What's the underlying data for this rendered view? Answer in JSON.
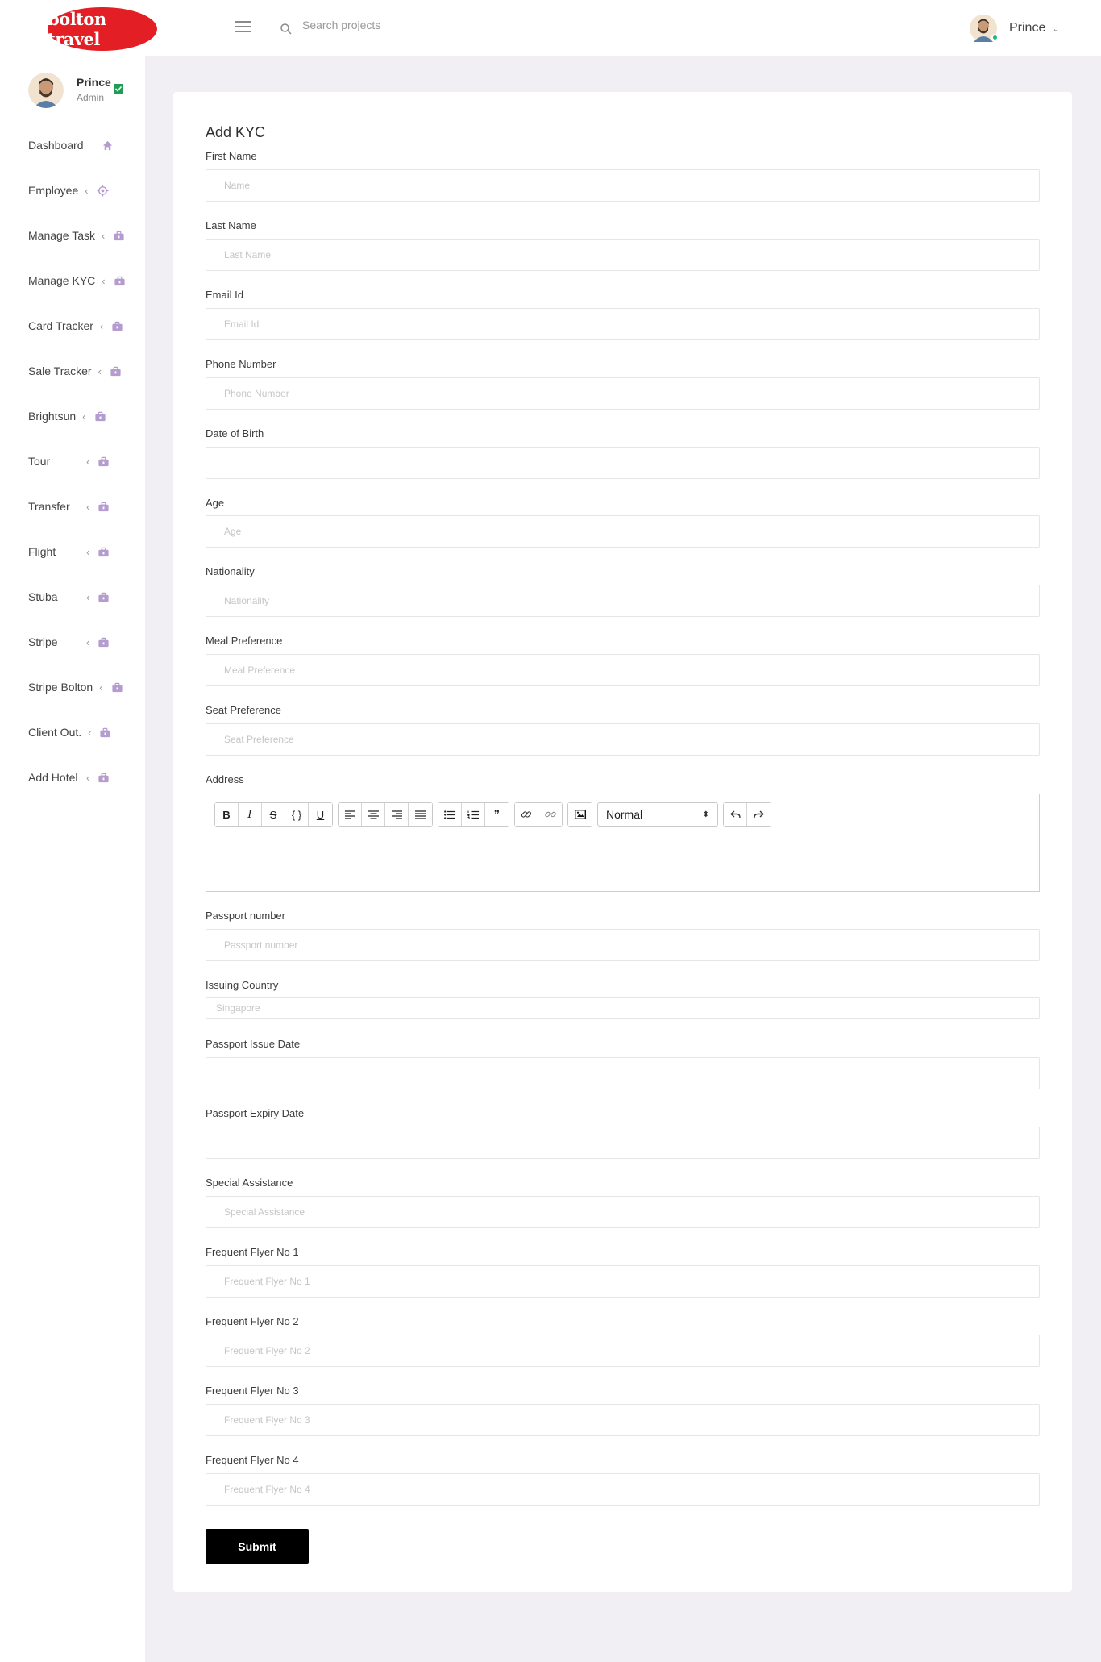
{
  "header": {
    "logo_text": "bolton travel",
    "search_placeholder": "Search projects",
    "user_name": "Prince"
  },
  "sidebar": {
    "profile": {
      "name": "Prince",
      "role": "Admin"
    },
    "items": [
      {
        "label": "Dashboard",
        "icon": "home-icon",
        "has_arrow": false
      },
      {
        "label": "Employee",
        "icon": "target-icon",
        "has_arrow": true
      },
      {
        "label": "Manage Task",
        "icon": "briefcase-icon",
        "has_arrow": true
      },
      {
        "label": "Manage KYC",
        "icon": "briefcase-icon",
        "has_arrow": true
      },
      {
        "label": "Card Tracker",
        "icon": "briefcase-icon",
        "has_arrow": true
      },
      {
        "label": "Sale Tracker",
        "icon": "briefcase-icon",
        "has_arrow": true
      },
      {
        "label": "Brightsun",
        "icon": "briefcase-icon",
        "has_arrow": true
      },
      {
        "label": "Tour",
        "icon": "briefcase-icon",
        "has_arrow": true
      },
      {
        "label": "Transfer",
        "icon": "briefcase-icon",
        "has_arrow": true
      },
      {
        "label": "Flight",
        "icon": "briefcase-icon",
        "has_arrow": true
      },
      {
        "label": "Stuba",
        "icon": "briefcase-icon",
        "has_arrow": true
      },
      {
        "label": "Stripe",
        "icon": "briefcase-icon",
        "has_arrow": true
      },
      {
        "label": "Stripe Bolton",
        "icon": "briefcase-icon",
        "has_arrow": true
      },
      {
        "label": "Client Out.",
        "icon": "briefcase-icon",
        "has_arrow": true
      },
      {
        "label": "Add Hotel",
        "icon": "briefcase-icon",
        "has_arrow": true
      }
    ]
  },
  "form": {
    "title": "Add KYC",
    "fields": {
      "first_name": {
        "label": "First Name",
        "placeholder": "Name",
        "value": ""
      },
      "last_name": {
        "label": "Last Name",
        "placeholder": "Last Name",
        "value": ""
      },
      "email": {
        "label": "Email Id",
        "placeholder": "Email Id",
        "value": ""
      },
      "phone": {
        "label": "Phone Number",
        "placeholder": "Phone Number",
        "value": ""
      },
      "dob": {
        "label": "Date of Birth",
        "placeholder": "",
        "value": ""
      },
      "age": {
        "label": "Age",
        "placeholder": "Age",
        "value": ""
      },
      "nationality": {
        "label": "Nationality",
        "placeholder": "Nationality",
        "value": ""
      },
      "meal": {
        "label": "Meal Preference",
        "placeholder": "Meal Preference",
        "value": ""
      },
      "seat": {
        "label": "Seat Preference",
        "placeholder": "Seat Preference",
        "value": ""
      },
      "address": {
        "label": "Address"
      },
      "passport_number": {
        "label": "Passport number",
        "placeholder": "Passport number",
        "value": ""
      },
      "issuing_country": {
        "label": "Issuing Country",
        "placeholder": "Singapore",
        "value": ""
      },
      "passport_issue": {
        "label": "Passport Issue Date",
        "placeholder": "",
        "value": ""
      },
      "passport_expiry": {
        "label": "Passport Expiry Date",
        "placeholder": "",
        "value": ""
      },
      "special_assistance": {
        "label": "Special Assistance",
        "placeholder": "Special Assistance",
        "value": ""
      },
      "ffn1": {
        "label": "Frequent Flyer No 1",
        "placeholder": "Frequent Flyer No 1",
        "value": ""
      },
      "ffn2": {
        "label": "Frequent Flyer No 2",
        "placeholder": "Frequent Flyer No 2",
        "value": ""
      },
      "ffn3": {
        "label": "Frequent Flyer No 3",
        "placeholder": "Frequent Flyer No 3",
        "value": ""
      },
      "ffn4": {
        "label": "Frequent Flyer No 4",
        "placeholder": "Frequent Flyer No 4",
        "value": ""
      }
    },
    "editor": {
      "buttons": {
        "bold": "B",
        "italic": "I",
        "strike": "S",
        "code": "{ }",
        "underline": "U",
        "quote": "❞"
      },
      "format_value": "Normal"
    },
    "submit_label": "Submit"
  },
  "colors": {
    "brand": "#e31e24",
    "icon": "#b59ccf",
    "page_bg": "#f2eff4",
    "submit": "#000000",
    "online": "#25b67a"
  }
}
